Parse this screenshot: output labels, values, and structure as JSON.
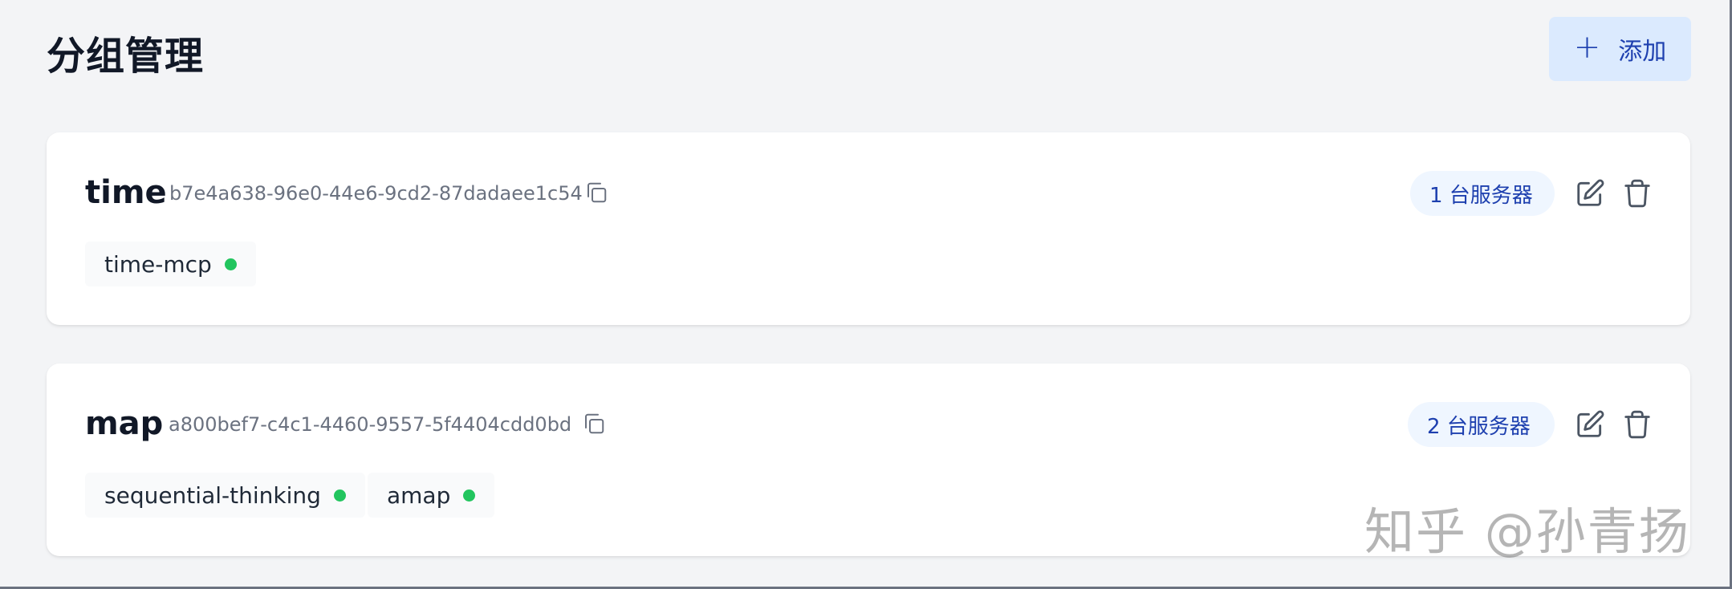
{
  "header": {
    "title": "分组管理",
    "add_button_label": "添加",
    "add_icon": "plus-icon"
  },
  "groups": [
    {
      "name": "time",
      "id": "b7e4a638-96e0-44e6-9cd2-87dadaee1c54",
      "server_count_label": "1 台服务器",
      "servers": [
        {
          "name": "time-mcp",
          "status": "online"
        }
      ]
    },
    {
      "name": "map",
      "id": "a800bef7-c4c1-4460-9557-5f4404cdd0bd",
      "server_count_label": "2 台服务器",
      "servers": [
        {
          "name": "sequential-thinking",
          "status": "online"
        },
        {
          "name": "amap",
          "status": "online"
        }
      ]
    }
  ],
  "icons": {
    "copy": "copy-icon",
    "edit": "edit-icon",
    "delete": "trash-icon"
  },
  "colors": {
    "accent": "#1e40af",
    "accent_bg": "#dbeafe",
    "status_online": "#22c55e",
    "background": "#f3f4f6"
  },
  "watermark": "知乎 @孙青扬"
}
